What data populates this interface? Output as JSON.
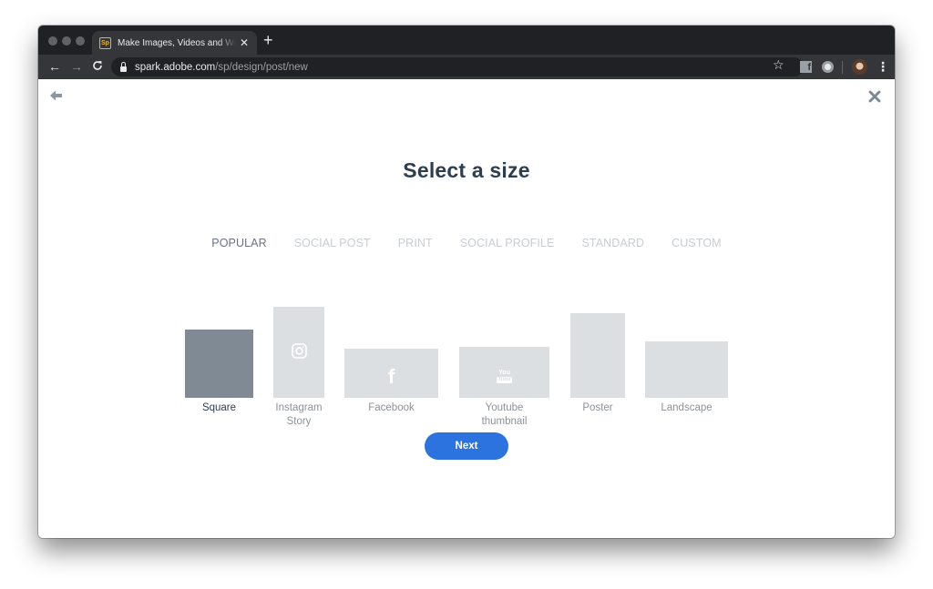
{
  "browser": {
    "tab": {
      "favicon": "Sp",
      "title": "Make Images, Videos and Web Stories",
      "close": "✕"
    },
    "new_tab": "+",
    "nav": {
      "back": "←",
      "forward": "→",
      "reload": "C"
    },
    "url": {
      "host": "spark.adobe.com",
      "path": "/sp/design/post/new"
    },
    "bookmark_star": "☆",
    "extension_facebook": "f",
    "menu": "⋮"
  },
  "page": {
    "title": "Select a size",
    "tabs": [
      {
        "label": "POPULAR",
        "active": true
      },
      {
        "label": "SOCIAL POST",
        "active": false
      },
      {
        "label": "PRINT",
        "active": false
      },
      {
        "label": "SOCIAL PROFILE",
        "active": false
      },
      {
        "label": "STANDARD",
        "active": false
      },
      {
        "label": "CUSTOM",
        "active": false
      }
    ],
    "sizes": [
      {
        "label": "Square",
        "icon": "none",
        "selected": true
      },
      {
        "label": "Instagram Story",
        "icon": "instagram-icon",
        "selected": false
      },
      {
        "label": "Facebook",
        "icon": "facebook-icon",
        "selected": false
      },
      {
        "label": "Youtube thumbnail",
        "icon": "youtube-icon",
        "selected": false
      },
      {
        "label": "Poster",
        "icon": "none",
        "selected": false
      },
      {
        "label": "Landscape",
        "icon": "none",
        "selected": false
      }
    ],
    "youtube_icon_text": {
      "top": "You",
      "bottom": "Tube"
    },
    "facebook_icon_text": "f",
    "next_label": "Next"
  },
  "colors": {
    "accent": "#2c73e0",
    "title": "#2c3e50",
    "selected_thumb": "#7f8a94",
    "thumb": "#dcdfe2"
  }
}
